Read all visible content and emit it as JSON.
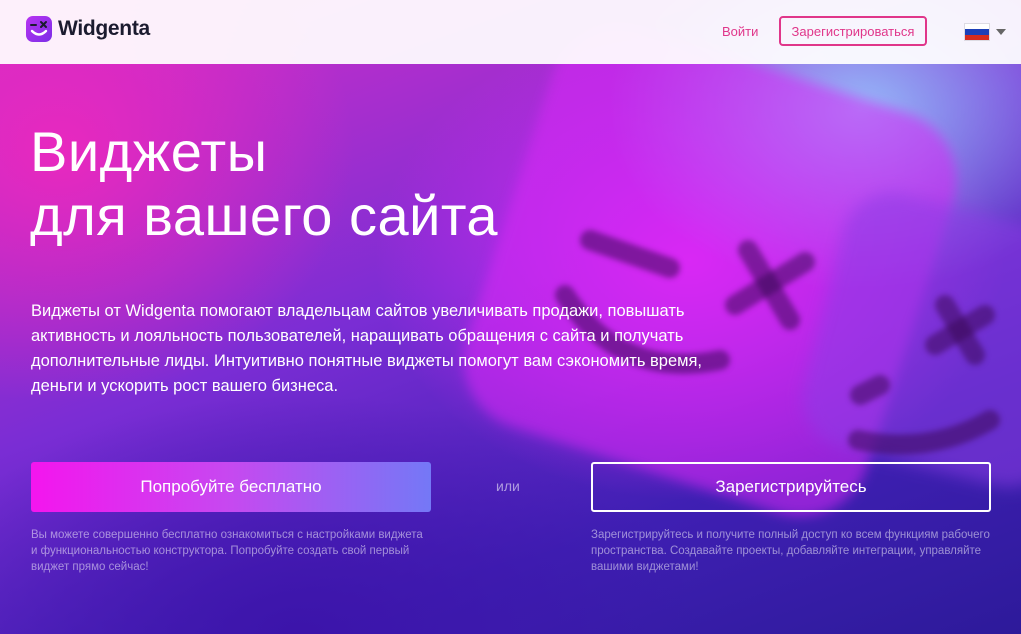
{
  "brand": {
    "name": "Widgenta",
    "logo_icon": "widgenta-face-icon",
    "accent_color": "#e0368a"
  },
  "header": {
    "login_label": "Войти",
    "register_label": "Зарегистрироваться",
    "language_flag": "russia-flag-icon"
  },
  "hero": {
    "title_line1": "Виджеты",
    "title_line2": "для вашего сайта",
    "description": "Виджеты от Widgenta помогают владельцам сайтов увеличивать продажи, повышать активность и лояльность пользователей, наращивать обращения с сайта и получать дополнительные лиды. Интуитивно понятные виджеты помогут вам сэкономить время, деньги и ускорить рост вашего бизнеса.",
    "try_button": "Попробуйте бесплатно",
    "or_label": "или",
    "register_button": "Зарегистрируйтесь",
    "try_note": "Вы можете совершенно бесплатно ознакомиться с настройками виджета и функциональностью конструктора. Попробуйте создать свой первый виджет прямо сейчас!",
    "register_note": "Зарегистрируйтесь и получите полный доступ ко всем функциям рабочего пространства. Создавайте проекты, добавляйте интеграции, управляйте вашими виджетами!"
  }
}
